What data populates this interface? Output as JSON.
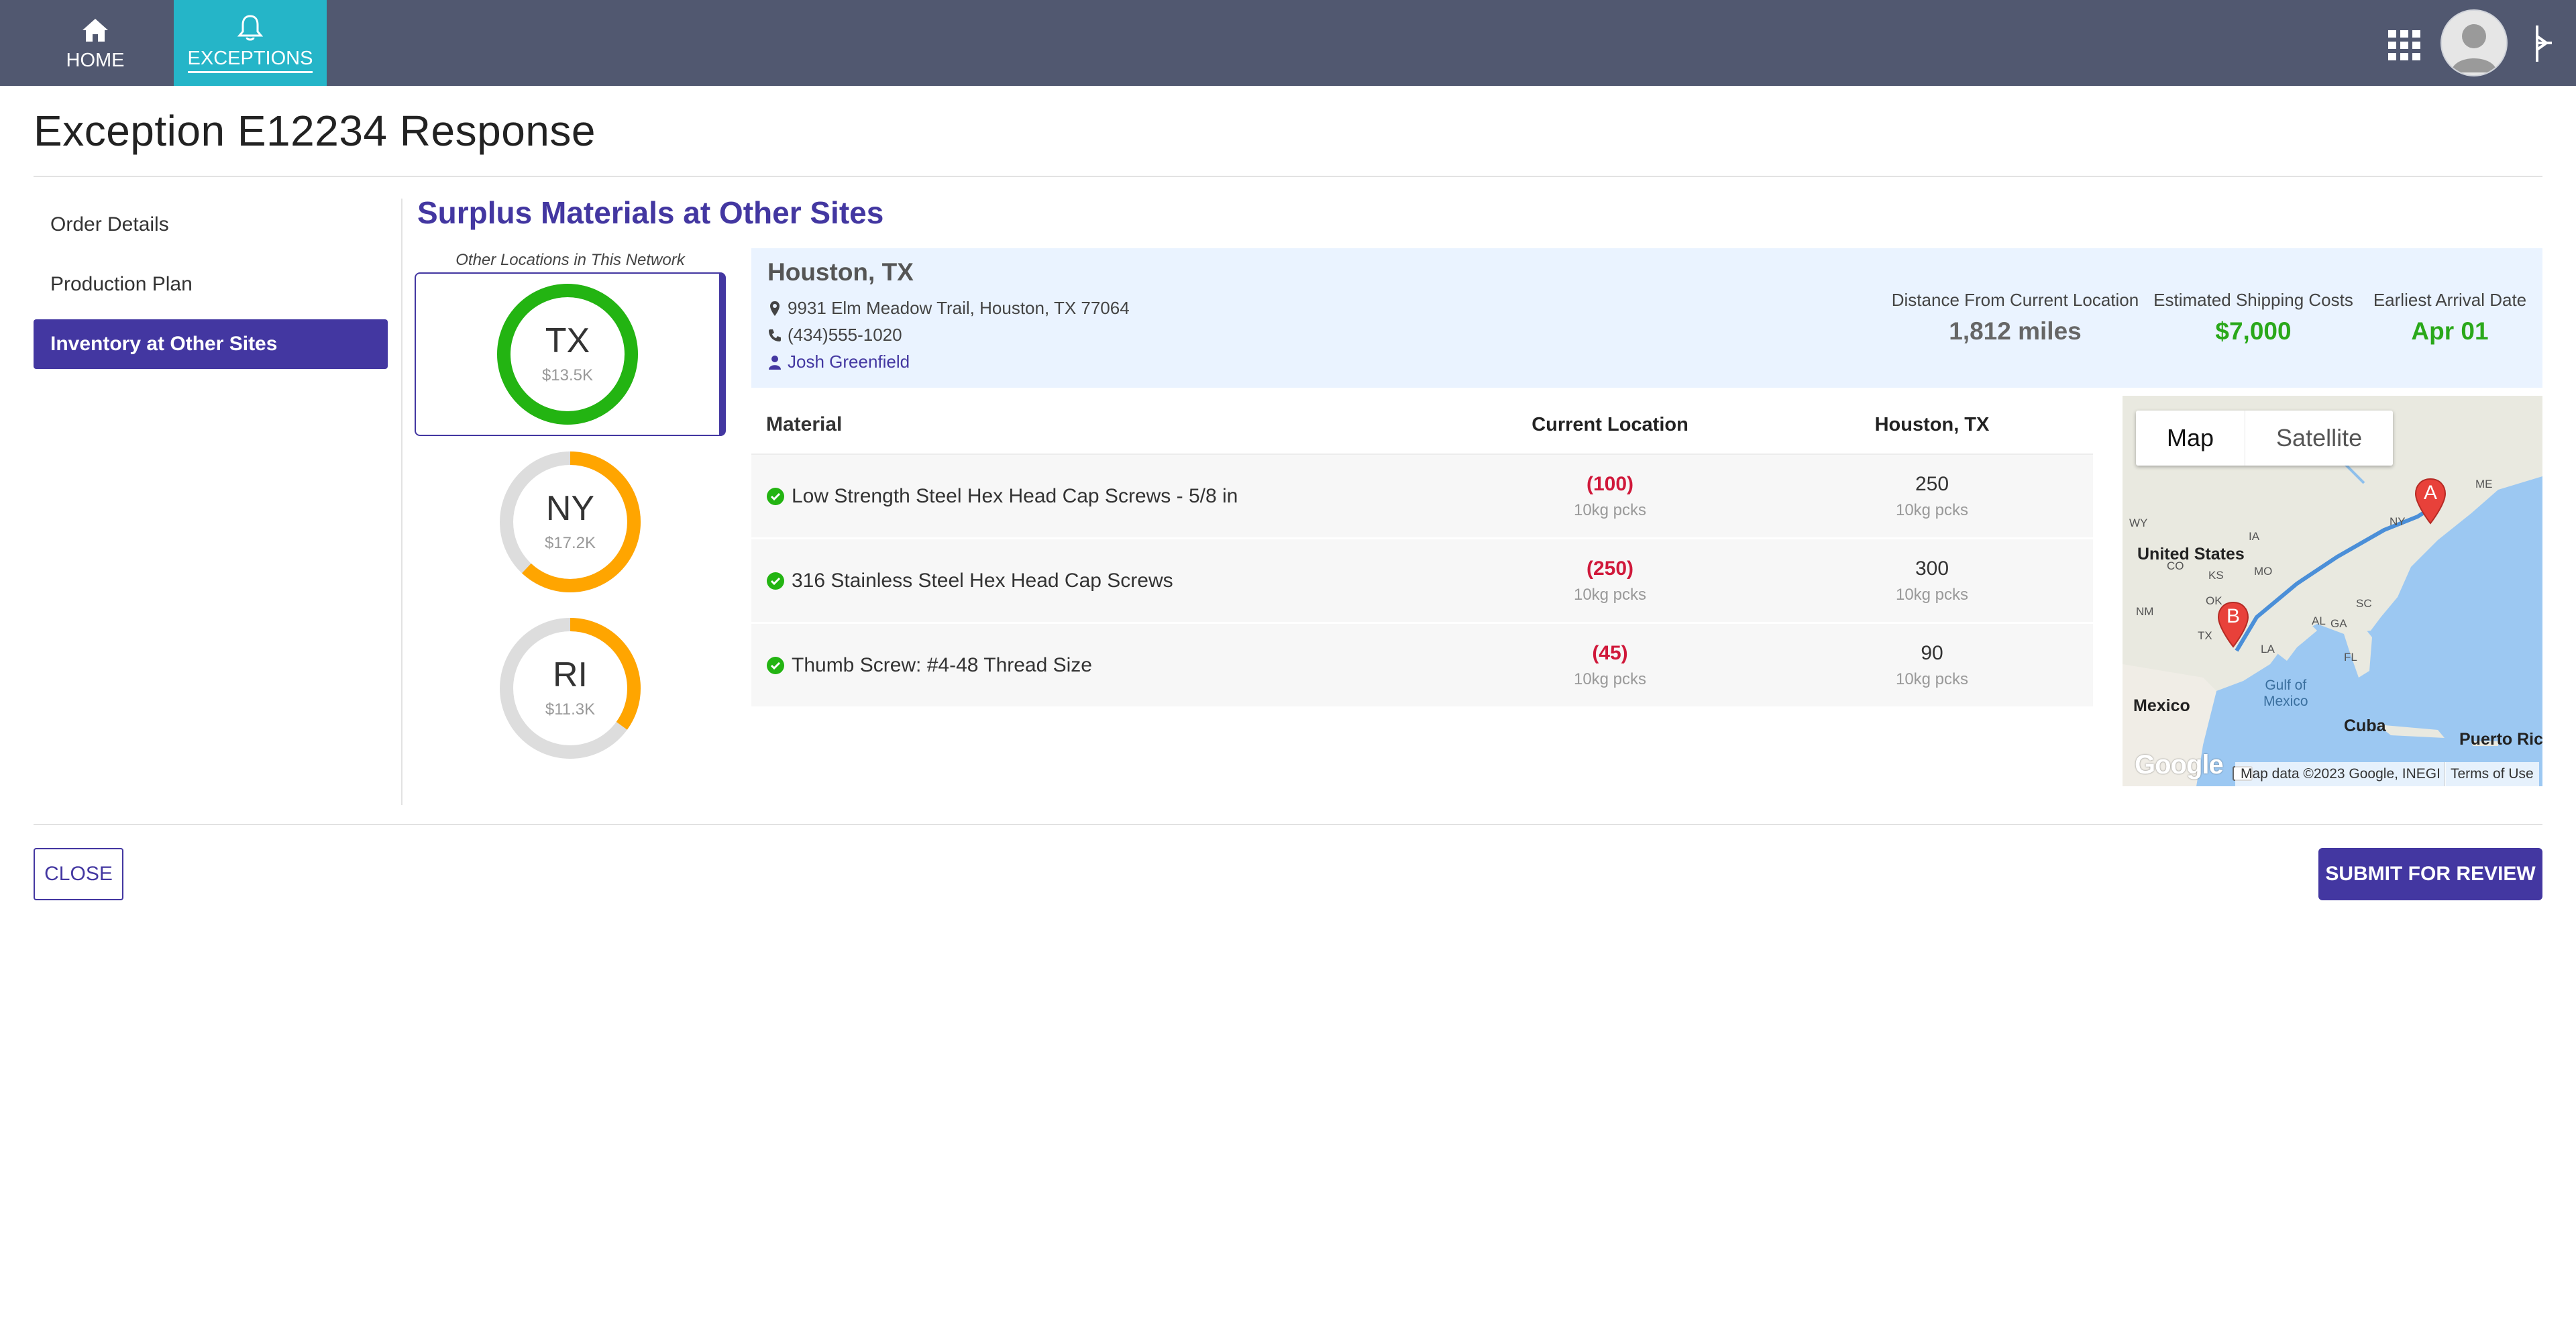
{
  "nav": {
    "home_label": "HOME",
    "exceptions_label": "EXCEPTIONS",
    "home_icon": "home-icon",
    "exceptions_icon": "bell-icon"
  },
  "page": {
    "title": "Exception E12234 Response"
  },
  "sidebar": {
    "items": [
      {
        "label": "Order Details",
        "active": false
      },
      {
        "label": "Production Plan",
        "active": false
      },
      {
        "label": "Inventory at Other Sites",
        "active": true
      }
    ]
  },
  "section": {
    "title": "Surplus Materials at Other Sites",
    "network_label": "Other Locations in This Network"
  },
  "sites": [
    {
      "code": "TX",
      "value": "$13.5K",
      "fraction": 1.0,
      "color": "#23b412",
      "selected": true
    },
    {
      "code": "NY",
      "value": "$17.2K",
      "fraction": 0.62,
      "color": "#ffa500",
      "selected": false
    },
    {
      "code": "RI",
      "value": "$11.3K",
      "fraction": 0.35,
      "color": "#ffa500",
      "selected": false
    }
  ],
  "location": {
    "city": "Houston, TX",
    "address": "9931 Elm Meadow Trail, Houston, TX 77064",
    "phone": "(434)555-1020",
    "contact": "Josh Greenfield",
    "stats": [
      {
        "label": "Distance From Current Location",
        "value": "1,812 miles",
        "color": "#666666"
      },
      {
        "label": "Estimated Shipping Costs",
        "value": "$7,000",
        "color": "#2aa81a"
      },
      {
        "label": "Earliest Arrival Date",
        "value": "Apr 01",
        "color": "#2aa81a"
      }
    ]
  },
  "table": {
    "headers": {
      "material": "Material",
      "current": "Current Location",
      "site": "Houston, TX"
    },
    "rows": [
      {
        "material": "Low Strength Steel Hex Head Cap Screws - 5/8 in",
        "current_qty": "(100)",
        "current_unit": "10kg pcks",
        "site_qty": "250",
        "site_unit": "10kg pcks"
      },
      {
        "material": "316 Stainless Steel Hex Head Cap Screws",
        "current_qty": "(250)",
        "current_unit": "10kg pcks",
        "site_qty": "300",
        "site_unit": "10kg pcks"
      },
      {
        "material": "Thumb Screw: #4-48 Thread Size",
        "current_qty": "(45)",
        "current_unit": "10kg pcks",
        "site_qty": "90",
        "site_unit": "10kg pcks"
      }
    ]
  },
  "map": {
    "tabs": [
      "Map",
      "Satellite"
    ],
    "active_tab": "Map",
    "marker_a": "A",
    "marker_b": "B",
    "labels": {
      "us": "United States",
      "mexico": "Mexico",
      "gulf": "Gulf of\nMexico",
      "cuba": "Cuba",
      "pr": "Puerto Rico",
      "wy": "WY",
      "nm": "NM",
      "tx": "TX",
      "la": "LA",
      "ny": "NY",
      "mo": "MO",
      "ia": "IA",
      "co": "CO",
      "ks": "KS",
      "ok": "OK",
      "al": "AL",
      "ga": "GA",
      "sc": "SC",
      "fl": "FL",
      "me": "ME"
    },
    "logo": "Google",
    "attribution": "Map data ©2023 Google, INEGI",
    "terms": "Terms of Use"
  },
  "buttons": {
    "close": "CLOSE",
    "submit": "SUBMIT FOR REVIEW"
  }
}
